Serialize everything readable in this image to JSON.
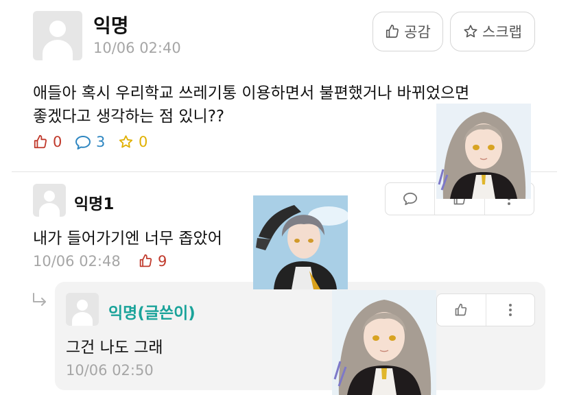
{
  "post": {
    "author": "익명",
    "timestamp": "10/06 02:40",
    "like_button_label": "공감",
    "scrap_button_label": "스크랩",
    "content_line1": "애들아 혹시 우리학교 쓰레기통 이용하면서 불편했거나 바뀌었으면",
    "content_line2": "좋겠다고 생각하는 점 있니??",
    "likes": "0",
    "comments": "3",
    "scraps": "0"
  },
  "comments": [
    {
      "author": "익명1",
      "text": "내가 들어가기엔 너무 좁았어",
      "timestamp": "10/06 02:48",
      "likes": "9"
    }
  ],
  "replies": [
    {
      "author": "익명(글쓴이)",
      "text": "그건 나도 그래",
      "timestamp": "10/06 02:50"
    }
  ],
  "colors": {
    "like_red": "#c0392b",
    "comment_blue": "#2e86c1",
    "scrap_yellow": "#e0b000",
    "op_teal": "#1aa39a",
    "meta_gray": "#a6a6a6",
    "reply_background": "#f3f3f3"
  },
  "icons": [
    "thumbs-up-icon",
    "star-icon",
    "speech-bubble-icon",
    "more-vertical-icon",
    "reply-arrow-icon"
  ]
}
